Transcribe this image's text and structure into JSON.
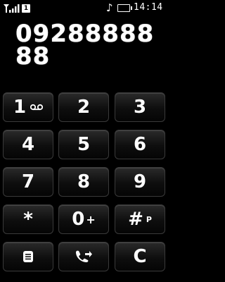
{
  "status": {
    "sim_label": "1",
    "time": "14:14",
    "signal_icon": "signal-bars",
    "music_icon": "music-note",
    "battery_icon": "battery"
  },
  "dialer": {
    "number": "0928888888"
  },
  "keys": {
    "k1": "1",
    "k2": "2",
    "k3": "3",
    "k4": "4",
    "k5": "5",
    "k6": "6",
    "k7": "7",
    "k8": "8",
    "k9": "9",
    "star": "*",
    "zero": "0",
    "zero_sub": "+",
    "hash": "#",
    "hash_sub": "P",
    "clear": "C"
  }
}
